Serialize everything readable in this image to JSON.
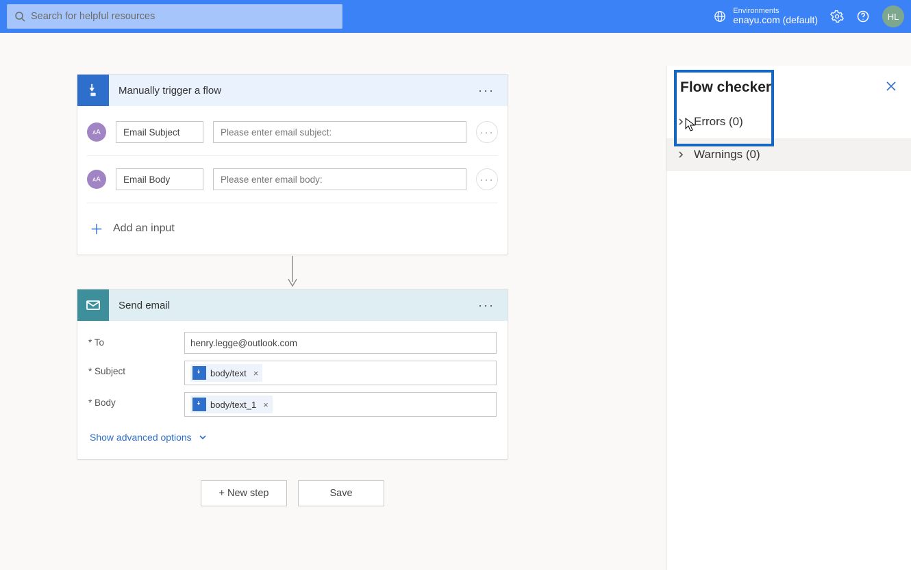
{
  "search": {
    "placeholder": "Search for helpful resources"
  },
  "environment": {
    "label": "Environments",
    "name": "enayu.com (default)"
  },
  "user": {
    "initials": "HL"
  },
  "trigger": {
    "title": "Manually trigger a flow",
    "params": [
      {
        "name": "Email Subject",
        "placeholder": "Please enter email subject:"
      },
      {
        "name": "Email Body",
        "placeholder": "Please enter email body:"
      }
    ],
    "add_input_label": "Add an input"
  },
  "action": {
    "title": "Send email",
    "fields": {
      "to_label": "* To",
      "to_value": "henry.legge@outlook.com",
      "subject_label": "* Subject",
      "subject_token": "body/text",
      "body_label": "* Body",
      "body_token": "body/text_1"
    },
    "advanced_label": "Show advanced options"
  },
  "buttons": {
    "new_step": "+ New step",
    "save": "Save"
  },
  "flow_checker": {
    "title": "Flow checker",
    "errors_label": "Errors (0)",
    "warnings_label": "Warnings (0)"
  }
}
